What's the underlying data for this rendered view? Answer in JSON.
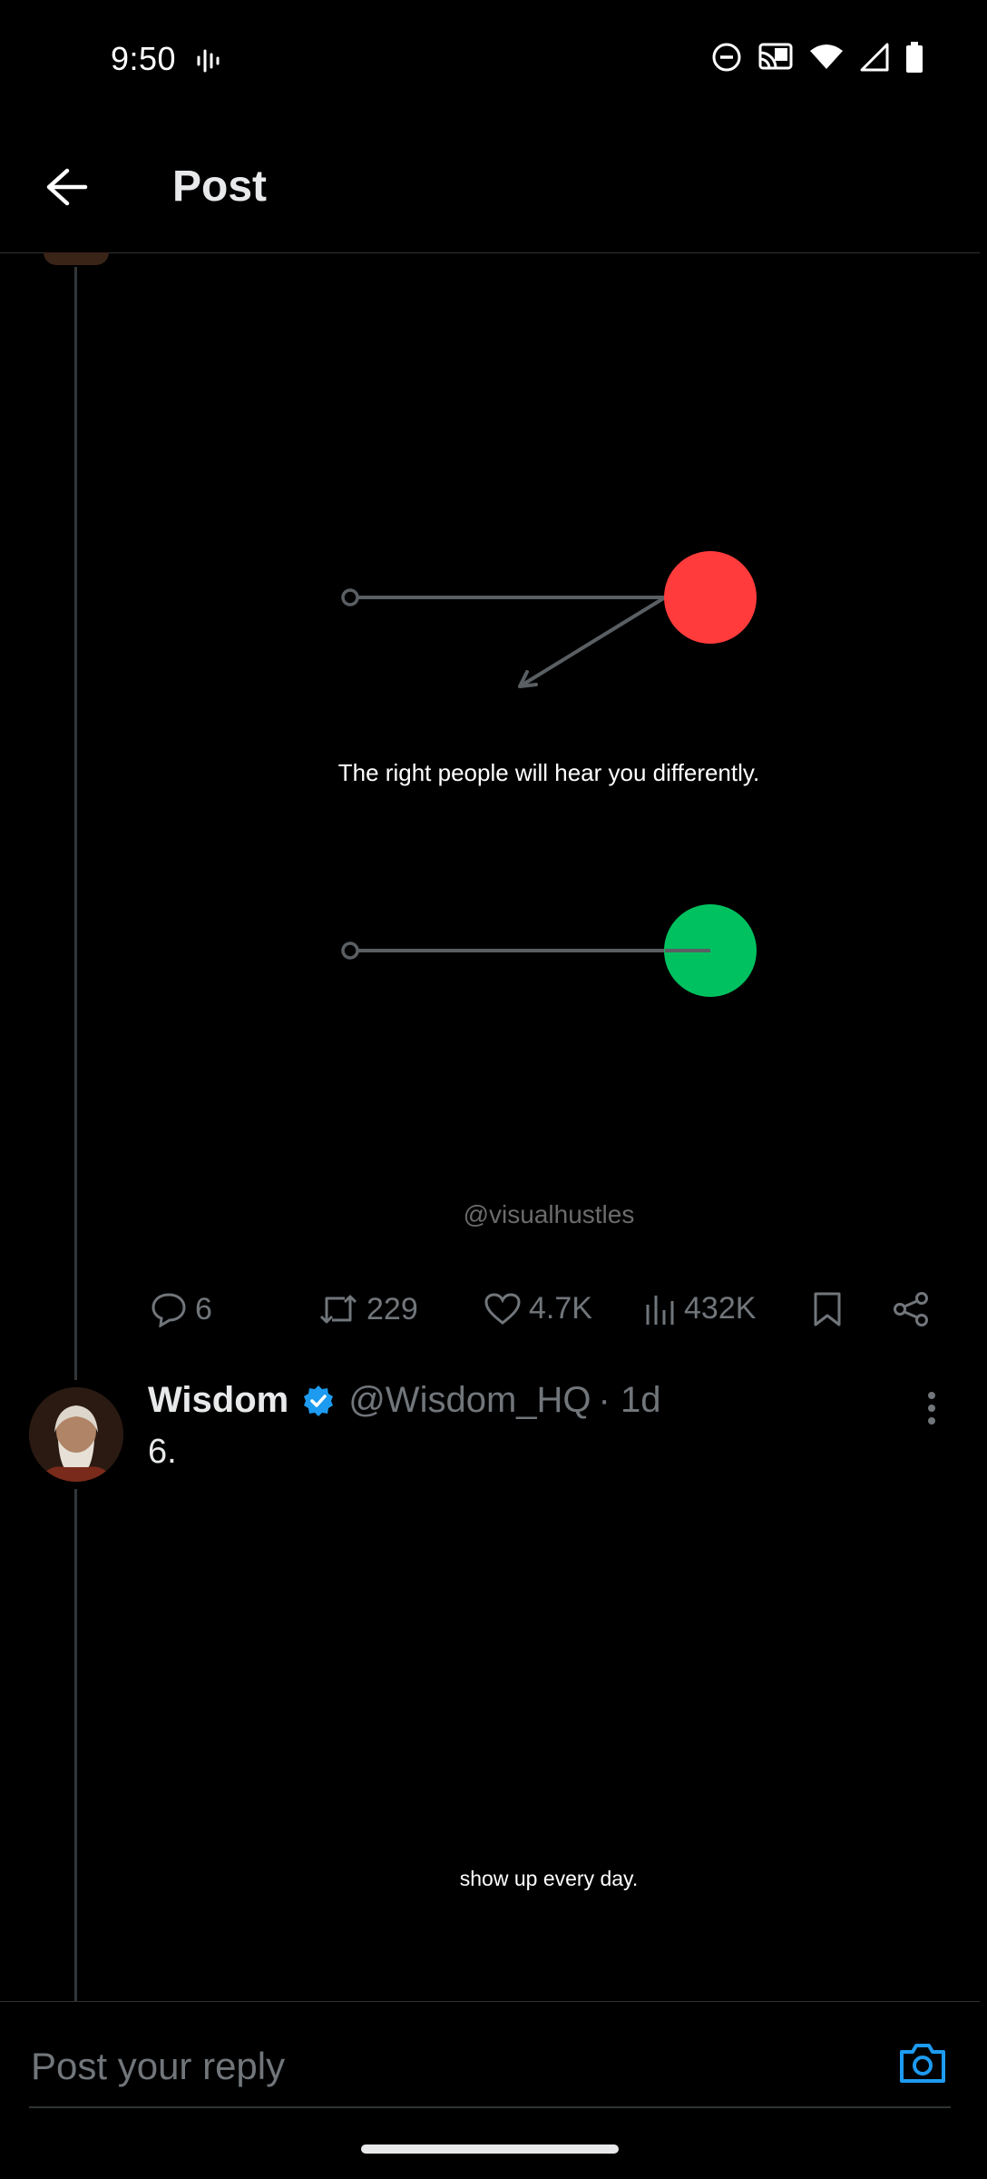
{
  "status_bar": {
    "time": "9:50"
  },
  "header": {
    "title": "Post"
  },
  "image1": {
    "caption": "The right people will hear you differently.",
    "watermark": "@visualhustles",
    "colors": {
      "red_dot": "#ff3b3b",
      "green_dot": "#00c160",
      "line": "#5a5f63"
    }
  },
  "actions": {
    "replies": "6",
    "reposts": "229",
    "likes": "4.7K",
    "views": "432K"
  },
  "post": {
    "author_name": "Wisdom",
    "handle": "@Wisdom_HQ",
    "time": "· 1d",
    "text": "6."
  },
  "image2": {
    "caption": "show up every day."
  },
  "reply": {
    "placeholder": "Post your reply"
  },
  "colors": {
    "accent": "#1d9bf0",
    "muted": "#71767b",
    "background": "#000000"
  }
}
